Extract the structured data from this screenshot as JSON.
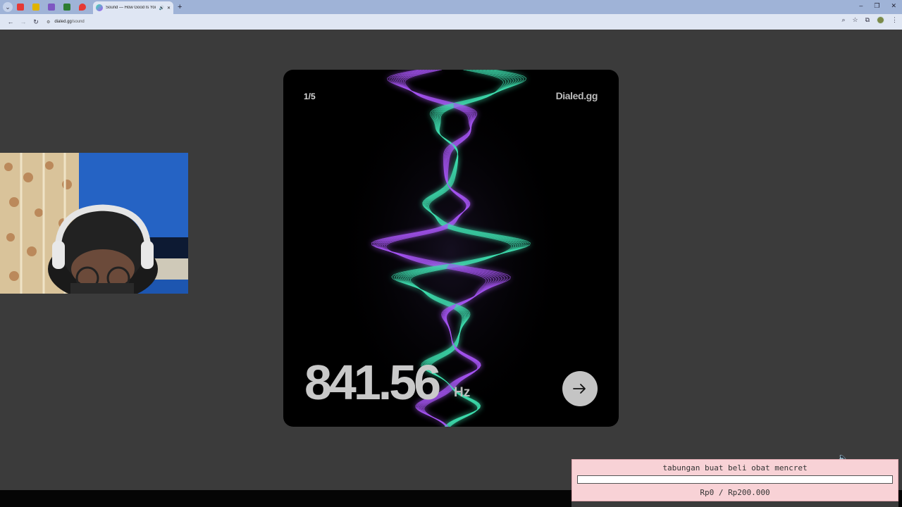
{
  "browser": {
    "tab_title": "Sound — How Good Is You",
    "tab_audio_icon": "speaker-icon",
    "new_tab_label": "+",
    "url_host": "dialed.gg",
    "url_path": "/sound",
    "window_controls": [
      "–",
      "❐",
      "✕"
    ],
    "pinned_tabs": [
      {
        "icon": "youtube-icon",
        "color": "#e53935"
      },
      {
        "icon": "notes-icon",
        "color": "#e0b300"
      },
      {
        "icon": "twitch-icon",
        "color": "#7e57c2"
      },
      {
        "icon": "x-app-icon",
        "color": "#2e7d32"
      },
      {
        "icon": "maps-icon",
        "color": "#e53935"
      }
    ]
  },
  "card": {
    "counter": "1/5",
    "brand": "Dialed.gg",
    "frequency": "841.56",
    "unit": "Hz",
    "next_icon": "arrow-right-icon",
    "wave_colors": {
      "green": "#3fe0b0",
      "purple": "#a855f7"
    }
  },
  "donation": {
    "title": "tabungan buat beli obat mencret",
    "amount": "Rp0 / Rp200.000",
    "progress": 0
  },
  "colors": {
    "page_bg": "#3b3b3b",
    "tabstrip": "#9fb3d7",
    "toolbar": "#dfe6f3",
    "card_bg": "#000000"
  }
}
